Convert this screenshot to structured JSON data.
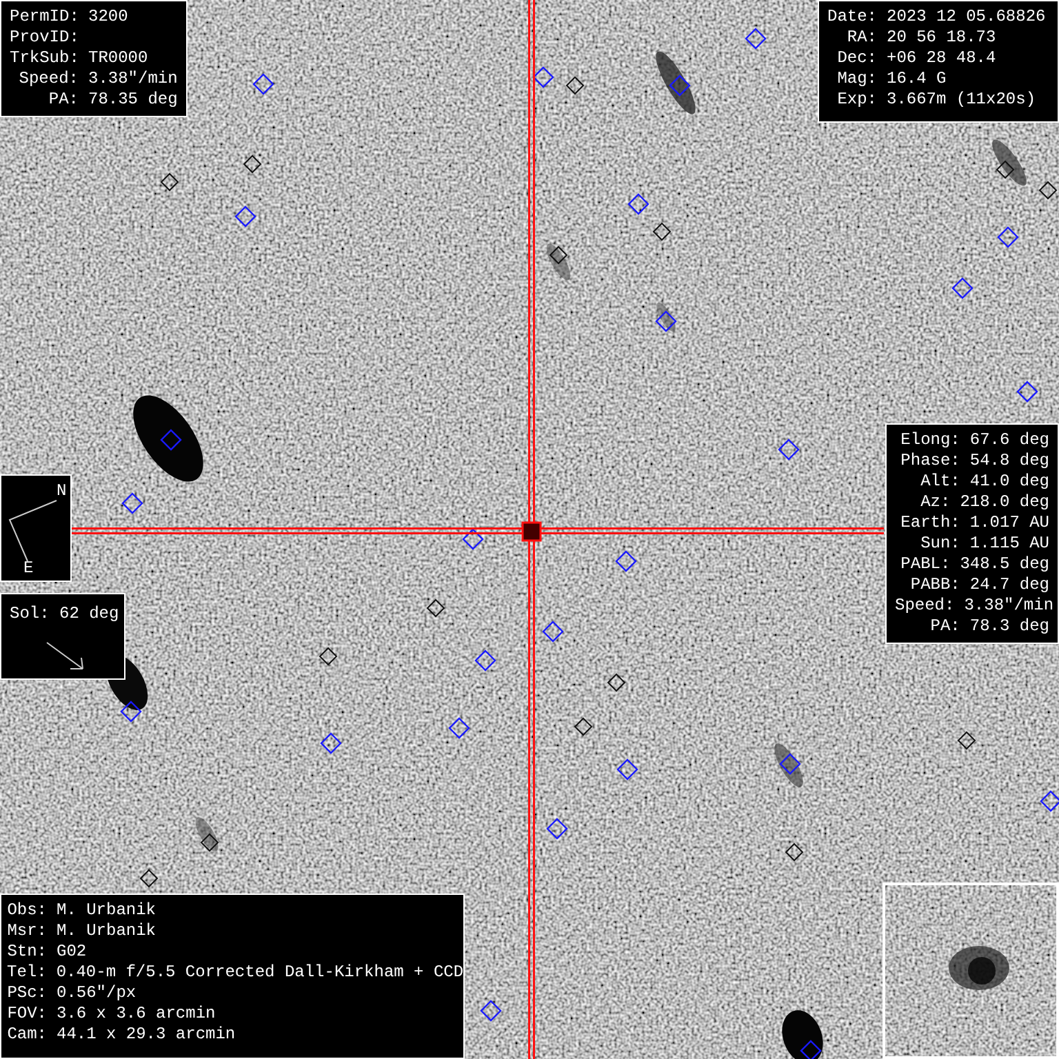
{
  "object_panel": {
    "lines": [
      {
        "label": "PermID:",
        "value": "3200"
      },
      {
        "label": "ProvID:"
      },
      {
        "label": "TrkSub:",
        "value": "TR0000"
      },
      {
        "label": "Speed:",
        "value": "3.38\"/min"
      },
      {
        "label": "PA:",
        "value": "78.35 deg"
      }
    ]
  },
  "observation_panel": {
    "lines": [
      {
        "label": "Date:",
        "value": "2023 12 05.68826"
      },
      {
        "label": "RA:",
        "value": "20 56 18.73"
      },
      {
        "label": "Dec:",
        "value": "+06 28 48.4"
      },
      {
        "label": "Mag:",
        "value": "16.4 G"
      },
      {
        "label": "Exp:",
        "value": "3.667m (11x20s)"
      }
    ]
  },
  "geometry_panel": {
    "lines": [
      {
        "label": "Elong:",
        "value": "67.6 deg"
      },
      {
        "label": "Phase:",
        "value": "54.8 deg"
      },
      {
        "label": "Alt:",
        "value": "41.0 deg"
      },
      {
        "label": "Az:",
        "value": "218.0 deg"
      },
      {
        "label": "Earth:",
        "value": "1.017 AU"
      },
      {
        "label": "Sun:",
        "value": "1.115 AU"
      },
      {
        "label": "PABL:",
        "value": "348.5 deg"
      },
      {
        "label": "PABB:",
        "value": "24.7 deg"
      },
      {
        "label": "Speed:",
        "value": "3.38\"/min"
      },
      {
        "label": "PA:",
        "value": "78.3 deg"
      }
    ]
  },
  "compass": {
    "north": "N",
    "east": "E"
  },
  "sun_panel": {
    "text": "Sol: 62 deg"
  },
  "instrument_panel": {
    "lines": [
      {
        "label": "Obs:",
        "value": "M. Urbanik"
      },
      {
        "label": "Msr:",
        "value": "M. Urbanik"
      },
      {
        "label": "Stn:",
        "value": "G02"
      },
      {
        "label": "Tel:",
        "value": "0.40-m f/5.5 Corrected Dall-Kirkham + CCD"
      },
      {
        "label": "PSc:",
        "value": "0.56\"/px"
      },
      {
        "label": "FOV:",
        "value": "3.6 x 3.6 arcmin"
      },
      {
        "label": "Cam:",
        "value": "44.1 x 29.3 arcmin"
      }
    ]
  }
}
